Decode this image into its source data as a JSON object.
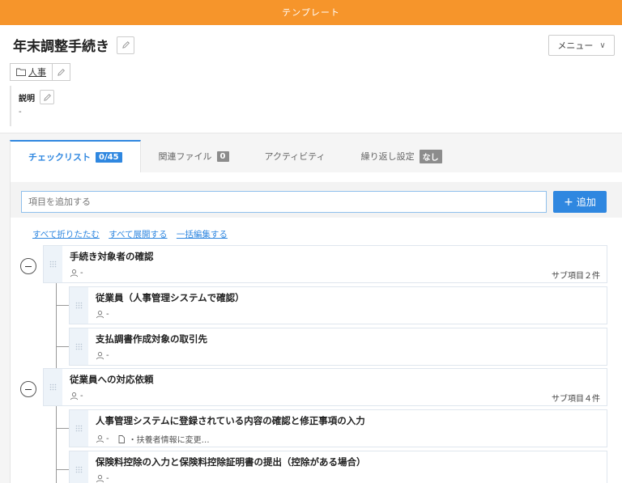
{
  "banner": "テンプレート",
  "title": "年末調整手続き",
  "menu": {
    "label": "メニュー"
  },
  "folder": {
    "label": "人事"
  },
  "description": {
    "label": "説明",
    "value": "-"
  },
  "tabs": [
    {
      "label": "チェックリスト",
      "badge": "0/45"
    },
    {
      "label": "関連ファイル",
      "badge": "0"
    },
    {
      "label": "アクティビティ",
      "badge": ""
    },
    {
      "label": "繰り返し設定",
      "badge": "なし"
    }
  ],
  "add": {
    "placeholder": "項目を追加する",
    "button": "追加"
  },
  "links": {
    "collapse_all": "すべて折りたたむ",
    "expand_all": "すべて展開する",
    "bulk_edit": "一括編集する"
  },
  "groups": [
    {
      "title": "手続き対象者の確認",
      "assignee": "-",
      "sub_count": "サブ項目２件",
      "children": [
        {
          "title": "従業員（人事管理システムで確認）",
          "assignee": "-"
        },
        {
          "title": "支払調書作成対象の取引先",
          "assignee": "-"
        }
      ]
    },
    {
      "title": "従業員への対応依頼",
      "assignee": "-",
      "sub_count": "サブ項目４件",
      "children": [
        {
          "title": "人事管理システムに登録されている内容の確認と修正事項の入力",
          "assignee": "-",
          "note": "・扶養者情報に変更…"
        },
        {
          "title": "保険料控除の入力と保険料控除証明書の提出（控除がある場合）",
          "assignee": "-"
        }
      ]
    }
  ]
}
